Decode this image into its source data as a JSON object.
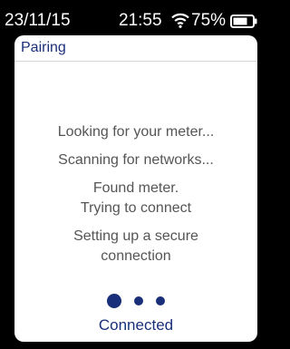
{
  "status_bar": {
    "date": "23/11/15",
    "time": "21:55",
    "battery_percent": "75%",
    "wifi_icon": "wifi-icon",
    "battery_icon": "battery-icon",
    "battery_level": 0.75
  },
  "header": {
    "title": "Pairing"
  },
  "messages": [
    "Looking for your meter...",
    "Scanning for networks...",
    "Found meter.\nTrying to connect",
    "Setting up a secure\nconnection"
  ],
  "progress": {
    "total_steps": 3,
    "current_step": 1
  },
  "status": "Connected",
  "colors": {
    "accent": "#1a2f7a",
    "message_text": "#555555",
    "status_bar_bg": "#000000",
    "screen_bg": "#ffffff"
  }
}
